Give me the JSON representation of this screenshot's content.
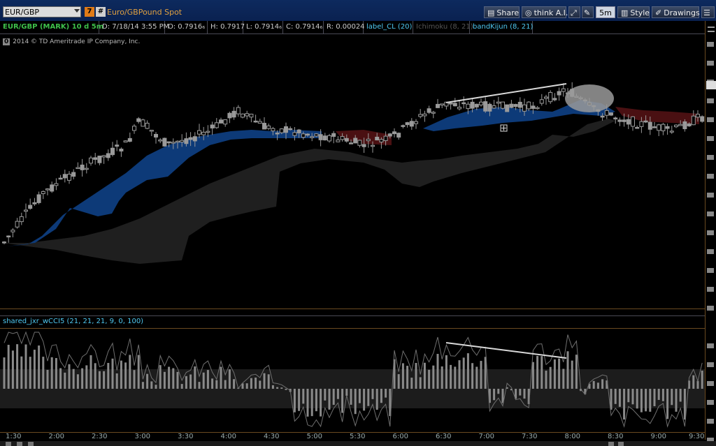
{
  "toolbar": {
    "symbol": "EUR/GBP",
    "orange_badge": "7",
    "hash_badge": "#",
    "description": "Euro/GBPound Spot",
    "share": "Share",
    "think_ai": "think A.I.",
    "timeframe": "5m",
    "style": "Style",
    "drawings": "Drawings"
  },
  "info": {
    "title": "EUR/GBP (MARK) 10 d 5m",
    "date": "D: 7/18/14 3:55 PM",
    "open": "O: 0.7916₆",
    "high": "H: 0.7917",
    "low": "L: 0.7914₆",
    "close": "C: 0.7914₆",
    "range": "R: 0.00024",
    "study1": "label_CL (20)",
    "study2": "Ichimoku (8, 21)",
    "study3": "bandKijun (8, 21)"
  },
  "copyright": {
    "badge": "0",
    "text": "2014 © TD Ameritrade IP Company, Inc."
  },
  "lower": {
    "study": "shared_jxr_wCCI5 (21, 21, 21, 9, 0, 100)"
  },
  "time_axis": [
    "1:30",
    "2:00",
    "2:30",
    "3:00",
    "3:30",
    "4:00",
    "4:30",
    "5:00",
    "5:30",
    "6:00",
    "6:30",
    "7:00",
    "7:30",
    "8:00",
    "8:30",
    "9:00",
    "9:30"
  ],
  "colors": {
    "bull_cloud": "#0d3a78",
    "bear_cloud": "#4a1012",
    "kumo_shadow": "#1f1f1f",
    "candle": "#9a9a9a",
    "cci_bar": "#8a8a8a",
    "label_blue": "#4fc8f0",
    "label_green": "#3ec04a"
  }
}
